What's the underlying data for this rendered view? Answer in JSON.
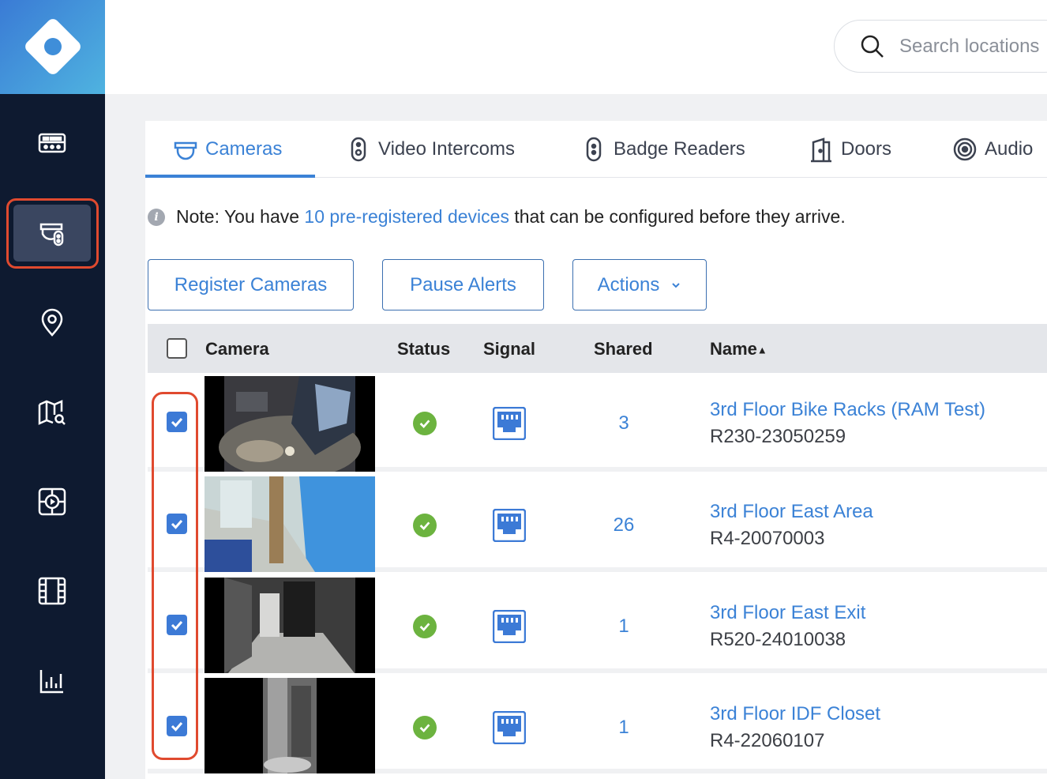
{
  "search": {
    "placeholder": "Search locations"
  },
  "sidebar": {
    "items": [
      {
        "icon": "dashboard-icon"
      },
      {
        "icon": "devices-icon",
        "active": true
      },
      {
        "icon": "location-pin-icon"
      },
      {
        "icon": "map-search-icon"
      },
      {
        "icon": "video-player-icon"
      },
      {
        "icon": "film-icon"
      },
      {
        "icon": "bar-chart-icon"
      }
    ]
  },
  "tabs": [
    {
      "label": "Cameras",
      "icon": "camera-icon",
      "active": true
    },
    {
      "label": "Video Intercoms",
      "icon": "intercom-icon"
    },
    {
      "label": "Badge Readers",
      "icon": "badge-reader-icon"
    },
    {
      "label": "Doors",
      "icon": "door-icon"
    },
    {
      "label": "Audio",
      "icon": "audio-icon"
    }
  ],
  "note": {
    "prefix": "Note: You have ",
    "link": "10 pre-registered devices",
    "suffix": " that can be configured before they arrive."
  },
  "buttons": {
    "register": "Register Cameras",
    "pause": "Pause Alerts",
    "actions": "Actions"
  },
  "table": {
    "headers": {
      "camera": "Camera",
      "status": "Status",
      "signal": "Signal",
      "shared": "Shared",
      "name": "Name"
    },
    "sort_indicator": "▲",
    "rows": [
      {
        "checked": true,
        "status": "online",
        "signal": "ethernet",
        "shared": "3",
        "name": "3rd Floor Bike Racks (RAM Test)",
        "id": "R230-23050259"
      },
      {
        "checked": true,
        "status": "online",
        "signal": "ethernet",
        "shared": "26",
        "name": "3rd Floor East Area",
        "id": "R4-20070003"
      },
      {
        "checked": true,
        "status": "online",
        "signal": "ethernet",
        "shared": "1",
        "name": "3rd Floor East Exit",
        "id": "R520-24010038"
      },
      {
        "checked": true,
        "status": "online",
        "signal": "ethernet",
        "shared": "1",
        "name": "3rd Floor IDF Closet",
        "id": "R4-22060107"
      }
    ]
  },
  "colors": {
    "accent": "#3b82d6",
    "sidebar_bg": "#0e1a30",
    "highlight": "#e04a2f",
    "status_ok": "#6cb33f"
  }
}
